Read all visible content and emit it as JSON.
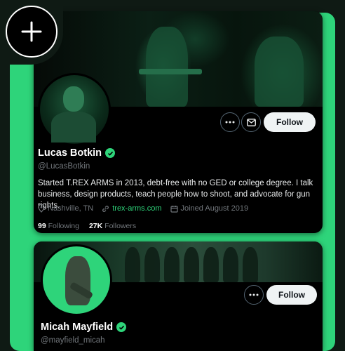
{
  "profile1": {
    "name": "Lucas Botkin",
    "handle": "@LucasBotkin",
    "bio": "Started T.REX ARMS in 2013, debt-free with no GED or college degree. I talk business, design products, teach people how to shoot, and advocate for gun rights.",
    "location": "Nashville, TN",
    "website": "trex-arms.com",
    "joined": "Joined August 2019",
    "following_count": "99",
    "following_label": "Following",
    "followers_count": "27K",
    "followers_label": "Followers",
    "follow_label": "Follow"
  },
  "profile2": {
    "name": "Micah Mayfield",
    "handle": "@mayfield_micah",
    "follow_label": "Follow"
  },
  "icons": {
    "more": "more-icon",
    "message": "mail-icon",
    "verified": "verified-badge-icon",
    "location": "location-pin-icon",
    "link": "link-icon",
    "calendar": "calendar-icon",
    "add": "plus-icon"
  },
  "colors": {
    "accent": "#2ed47a",
    "card": "#000000",
    "muted": "#71767b",
    "follow_button": "#eff3f4"
  }
}
